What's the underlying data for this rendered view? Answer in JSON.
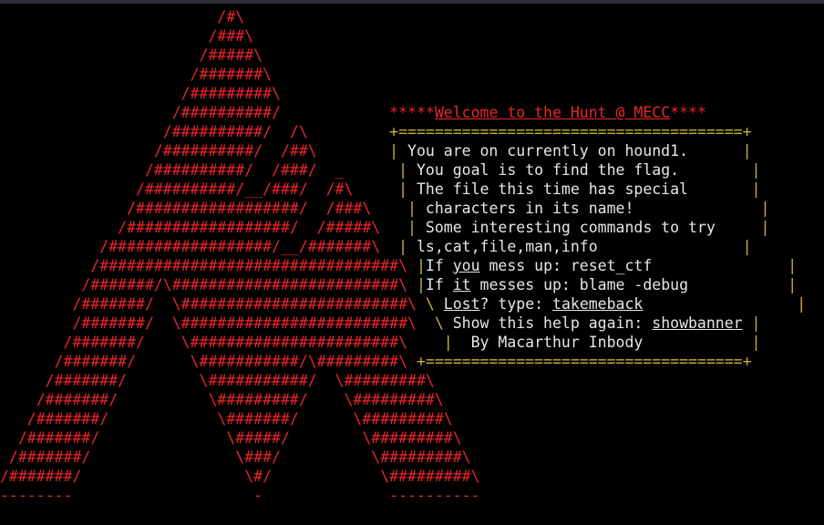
{
  "colors": {
    "background": "#000000",
    "red": "#e8262b",
    "yellow": "#c8b13a",
    "white": "#e6e6e6"
  },
  "rows": [
    [
      {
        "t": "                        /#\\",
        "c": "red"
      }
    ],
    [
      {
        "t": "                       /###\\",
        "c": "red"
      }
    ],
    [
      {
        "t": "                      /#####\\",
        "c": "red"
      }
    ],
    [
      {
        "t": "                     /#######\\",
        "c": "red"
      }
    ],
    [
      {
        "t": "                    /#########\\",
        "c": "red"
      }
    ],
    [
      {
        "t": "                   /##########/",
        "c": "red"
      },
      {
        "t": "            *****",
        "c": "red"
      },
      {
        "t": "Welcome to the Hunt @ MECC",
        "c": "red",
        "u": true
      },
      {
        "t": "****",
        "c": "red"
      }
    ],
    [
      {
        "t": "                  /##########/  /\\",
        "c": "red"
      },
      {
        "t": "         +======================================+",
        "c": "yellow"
      }
    ],
    [
      {
        "t": "                 /##########/  /##\\",
        "c": "red"
      },
      {
        "t": "        | ",
        "c": "yellow"
      },
      {
        "t": "You are on currently on hound1.",
        "c": "white"
      },
      {
        "t": "      |",
        "c": "yellow"
      }
    ],
    [
      {
        "t": "                /##########/  /###/  _",
        "c": "red"
      },
      {
        "t": "      | ",
        "c": "yellow"
      },
      {
        "t": "You goal is to find the flag.",
        "c": "white"
      },
      {
        "t": "        |",
        "c": "yellow"
      }
    ],
    [
      {
        "t": "               /##########/__/###/  /#\\",
        "c": "red"
      },
      {
        "t": "     | ",
        "c": "yellow"
      },
      {
        "t": "The file this time has special",
        "c": "white"
      },
      {
        "t": "       |",
        "c": "yellow"
      }
    ],
    [
      {
        "t": "              /##################/  /###\\",
        "c": "red"
      },
      {
        "t": "    | ",
        "c": "yellow"
      },
      {
        "t": "characters in its name!",
        "c": "white"
      },
      {
        "t": "              |",
        "c": "yellow"
      }
    ],
    [
      {
        "t": "             /##################/  /#####\\",
        "c": "red"
      },
      {
        "t": "   | ",
        "c": "yellow"
      },
      {
        "t": "Some interesting commands to try",
        "c": "white"
      },
      {
        "t": "     |",
        "c": "yellow"
      }
    ],
    [
      {
        "t": "           /##################/__/#######\\",
        "c": "red"
      },
      {
        "t": "  | ",
        "c": "yellow"
      },
      {
        "t": "ls,cat,file,man,info",
        "c": "white"
      },
      {
        "t": "                |",
        "c": "yellow"
      }
    ],
    [
      {
        "t": "          /#################################\\",
        "c": "red"
      },
      {
        "t": " |",
        "c": "yellow"
      },
      {
        "t": "If ",
        "c": "white"
      },
      {
        "t": "you",
        "c": "white",
        "u": true
      },
      {
        "t": " mess up: reset_ctf",
        "c": "white"
      },
      {
        "t": "               |",
        "c": "yellow"
      }
    ],
    [
      {
        "t": "         /#######/\\#########################\\",
        "c": "red"
      },
      {
        "t": " |",
        "c": "yellow"
      },
      {
        "t": "If ",
        "c": "white"
      },
      {
        "t": "it",
        "c": "white",
        "u": true
      },
      {
        "t": " messes up: blame -debug",
        "c": "white"
      },
      {
        "t": "           |",
        "c": "yellow"
      }
    ],
    [
      {
        "t": "        /#######/  \\#########################\\",
        "c": "red"
      },
      {
        "t": " \\ ",
        "c": "yellow"
      },
      {
        "t": "Lost",
        "c": "white",
        "u": true
      },
      {
        "t": "? type: ",
        "c": "white"
      },
      {
        "t": "takemeback",
        "c": "white",
        "u": true
      },
      {
        "t": "                 |",
        "c": "yellow"
      }
    ],
    [
      {
        "t": "        /#######/  \\#########################\\",
        "c": "red"
      },
      {
        "t": "  \\ ",
        "c": "yellow"
      },
      {
        "t": "Show this help again: ",
        "c": "white"
      },
      {
        "t": "showbanner",
        "c": "white",
        "u": true
      },
      {
        "t": " |",
        "c": "yellow"
      }
    ],
    [
      {
        "t": "       /#######/    \\#######################\\",
        "c": "red"
      },
      {
        "t": "    |  ",
        "c": "yellow"
      },
      {
        "t": "By Macarthur Inbody",
        "c": "white"
      },
      {
        "t": "            |",
        "c": "yellow"
      }
    ],
    [
      {
        "t": "      /#######/      \\###########/\\#########\\",
        "c": "red"
      },
      {
        "t": " +===================================+",
        "c": "yellow"
      }
    ],
    [
      {
        "t": "     /#######/        \\###########/  \\#########\\",
        "c": "red"
      }
    ],
    [
      {
        "t": "    /#######/          \\#########/    \\#########\\",
        "c": "red"
      }
    ],
    [
      {
        "t": "   /#######/            \\#######/      \\#########\\",
        "c": "red"
      }
    ],
    [
      {
        "t": "  /#######/              \\#####/        \\#########\\",
        "c": "red"
      }
    ],
    [
      {
        "t": " /#######/                \\###/          \\#########\\",
        "c": "red"
      }
    ],
    [
      {
        "t": "/#######/                  \\#/            \\#########\\",
        "c": "red"
      }
    ],
    [
      {
        "t": "--------                    -              ----------",
        "c": "red"
      }
    ]
  ]
}
